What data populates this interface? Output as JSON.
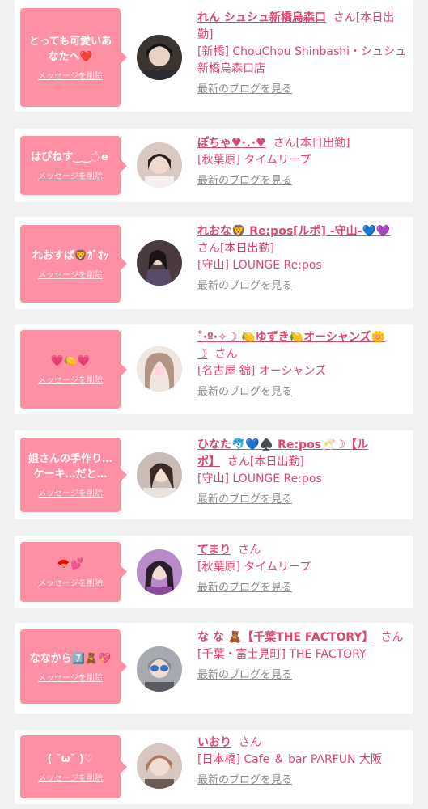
{
  "delete_label": "メッセージを削除",
  "blog_label": "最新のブログを見る",
  "san": "さん",
  "colors": {
    "accent": "#e0466d",
    "bubble": "#ff8fa3",
    "page_bg": "#f1f1f1"
  },
  "cards": [
    {
      "message": "とっても可愛いあなたへ❤️",
      "name": "れん シュシュ新橋烏森口",
      "status": "[本日出勤]",
      "shop": "[新橋] ChouChou Shinbashi・シュシュ新橋烏森口店"
    },
    {
      "message": "はぴねす‿‿◌̀ｅ",
      "name": "ぽちゃ♥·．·♥",
      "status": "[本日出勤]",
      "shop": "[秋葉原] タイムリープ"
    },
    {
      "message": "れおすぱ🦁ｶﾞｵｯ",
      "name": "れおな🦁 Re:pos[ルポ] -守山-💙💜",
      "status": "[本日出勤]",
      "shop": "[守山] LOUNGE Re:pos"
    },
    {
      "message": "💗🍋💗",
      "name": "˚‧º·✧☽ 🍋ゆずき🍋オーシャンズ🌼☽",
      "status": "",
      "shop": "[名古屋 錦] オーシャンズ"
    },
    {
      "message": "姐さんの手作り…ケーキ…だと…",
      "name": "ひなた🐬💙♠️ Re:pos🥂☽【ルポ】",
      "status": "[本日出勤]",
      "shop": "[守山] LOUNGE Re:pos"
    },
    {
      "message": "🪭💕",
      "name": "てまり",
      "status": "",
      "shop": "[秋葉原] タイムリープ"
    },
    {
      "message": "ななから7️⃣🧸💖",
      "name": "な な 🧸【千葉THE FACTORY】",
      "status": "",
      "shop": "[千葉・富士見町] THE FACTORY"
    },
    {
      "message": "( ˘ω˘ )♡",
      "name": "いおり",
      "status": "",
      "shop": "[日本橋] Cafe ＆ bar PARFUN 大阪"
    }
  ]
}
